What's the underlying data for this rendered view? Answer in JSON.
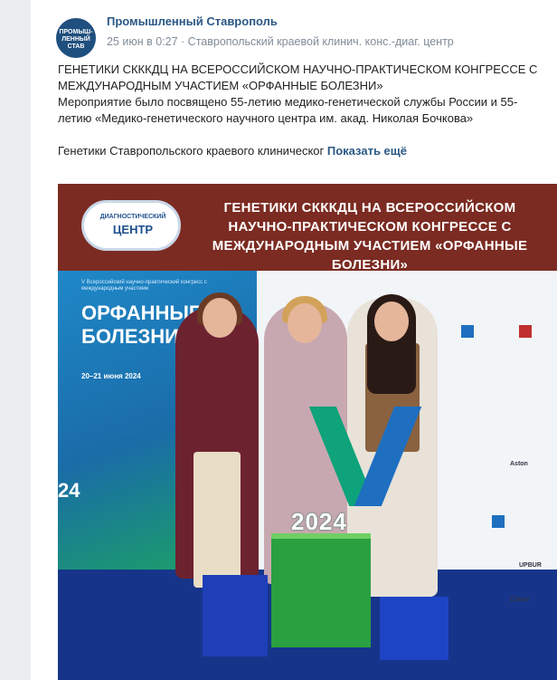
{
  "post": {
    "author": "Промышленный Ставрополь",
    "avatar_text": "ПРОМЫШ-ЛЕННЫЙ СТАВ",
    "meta": "25 июн в 0:27 · Ставропольский краевой клинич. конс.-диаг. центр",
    "more_icon": "•••",
    "text": {
      "title": "ГЕНЕТИКИ СКККДЦ НА ВСЕРОССИЙСКОМ НАУЧНО-ПРАКТИЧЕСКОМ КОНГРЕССЕ С МЕЖДУНАРОДНЫМ УЧАСТИЕМ «ОРФАННЫЕ БОЛЕЗНИ»",
      "body": "Мероприятие было посвящено 55-летию медико-генетической службы России и 55-летию «Медико-генетического научного центра им. акад. Николая Бочкова»",
      "teaser": "Генетики Ставропольского краевого клиническог",
      "show_more": "Показать ещё"
    }
  },
  "photo": {
    "logo_top": "ДИАГНОСТИЧЕСКИЙ",
    "logo_main": "ЦЕНТР",
    "banner_title": "ГЕНЕТИКИ СКККДЦ НА ВСЕРОССИЙСКОМ НАУЧНО-ПРАКТИЧЕСКОМ КОНГРЕССЕ С МЕЖДУНАРОДНЫМ УЧАСТИЕМ «ОРФАННЫЕ БОЛЕЗНИ»",
    "backdrop_small": "V Всероссийский научно-практический конгресс с международным участием",
    "backdrop_title": "ОРФАННЫЕ БОЛЕЗНИ",
    "backdrop_dates": "20–21 июня 2024",
    "backdrop_year": "24",
    "sign_year": "2024",
    "logos": [
      "Aston",
      "UPBUR",
      "Chiesi"
    ]
  },
  "colors": {
    "link": "#2a5885",
    "banner": "#7b2b22",
    "meta": "#818c99"
  }
}
